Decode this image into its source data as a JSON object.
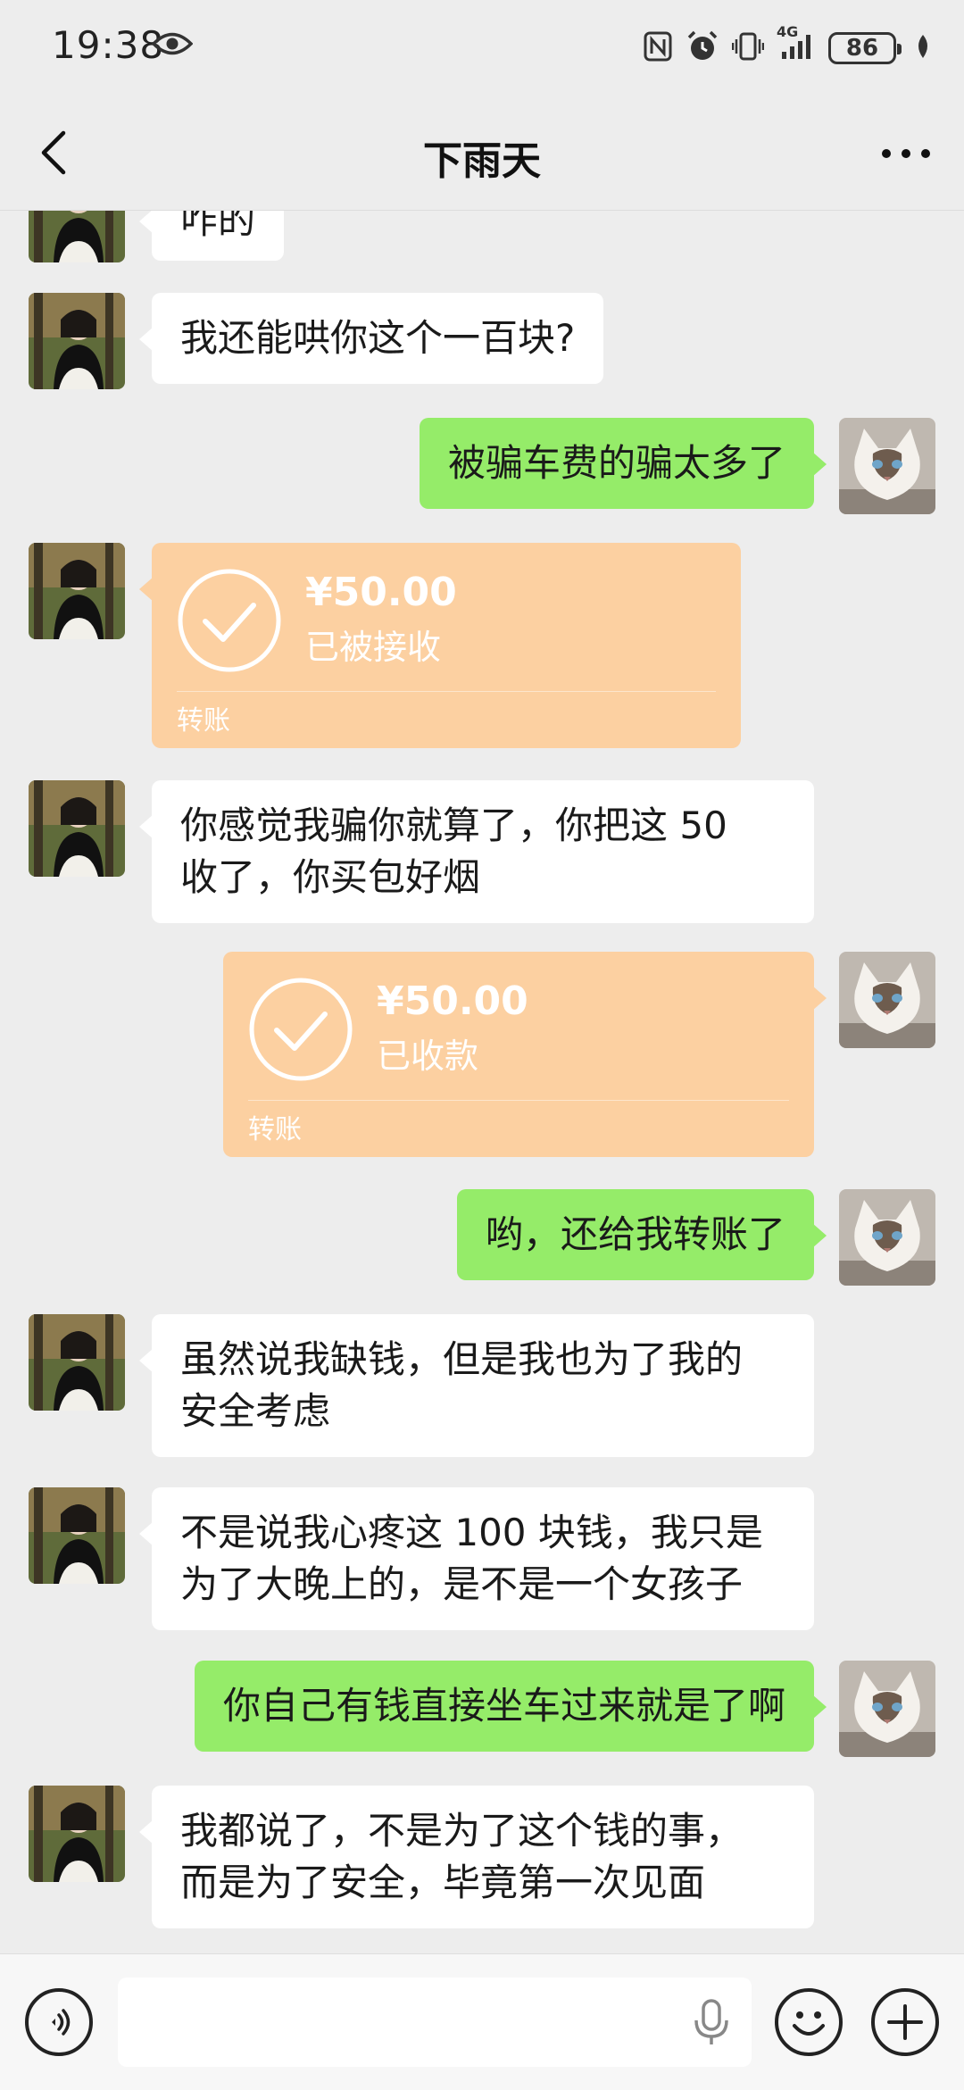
{
  "status_bar": {
    "time": "19:38",
    "network": "4G",
    "battery": "86",
    "icons": [
      "eye-icon",
      "nfc-icon",
      "alarm-icon",
      "vibrate-icon",
      "signal-icon",
      "battery-icon",
      "leaf-icon"
    ]
  },
  "header": {
    "title": "下雨天",
    "back_icon": "chevron-left-icon",
    "more_icon": "more-dots-icon"
  },
  "messages": [
    {
      "side": "in",
      "type": "text",
      "text": "咋的",
      "partial": true
    },
    {
      "side": "in",
      "type": "text",
      "text": "我还能哄你这个一百块?"
    },
    {
      "side": "out",
      "type": "text",
      "text": "被骗车费的骗太多了"
    },
    {
      "side": "in",
      "type": "transfer",
      "amount": "¥50.00",
      "status": "已被接收",
      "label": "转账"
    },
    {
      "side": "in",
      "type": "text",
      "lines": [
        "你感觉我骗你就算了，你把这 50",
        "收了，你买包好烟"
      ]
    },
    {
      "side": "out",
      "type": "transfer",
      "amount": "¥50.00",
      "status": "已收款",
      "label": "转账"
    },
    {
      "side": "out",
      "type": "text",
      "text": "哟，还给我转账了"
    },
    {
      "side": "in",
      "type": "text",
      "lines": [
        "虽然说我缺钱，但是我也为了我的",
        "安全考虑"
      ]
    },
    {
      "side": "in",
      "type": "text",
      "lines": [
        "不是说我心疼这 100 块钱，我只是",
        "为了大晚上的，是不是一个女孩子"
      ]
    },
    {
      "side": "out",
      "type": "text",
      "text": "你自己有钱直接坐车过来就是了啊"
    },
    {
      "side": "in",
      "type": "text",
      "lines": [
        "我都说了，不是为了这个钱的事，",
        "而是为了安全，毕竟第一次见面"
      ]
    }
  ],
  "colors": {
    "background": "#ededed",
    "bubble_in": "#ffffff",
    "bubble_out": "#95ec69",
    "transfer": "#fcd0a1"
  },
  "input_bar": {
    "icons": [
      "voice-icon",
      "mic-icon",
      "emoji-icon",
      "plus-icon"
    ]
  }
}
